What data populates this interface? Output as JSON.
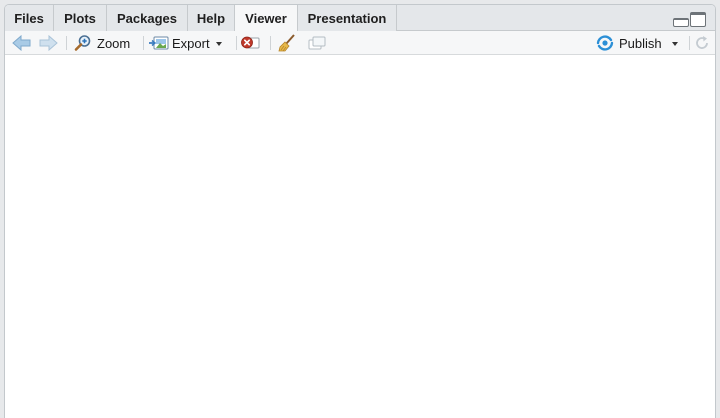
{
  "tabs": [
    {
      "label": "Files",
      "active": false
    },
    {
      "label": "Plots",
      "active": false
    },
    {
      "label": "Packages",
      "active": false
    },
    {
      "label": "Help",
      "active": false
    },
    {
      "label": "Viewer",
      "active": true
    },
    {
      "label": "Presentation",
      "active": false
    }
  ],
  "toolbar": {
    "back_icon": "arrow-left-icon",
    "forward_icon": "arrow-right-icon",
    "zoom_label": "Zoom",
    "export_label": "Export",
    "remove_icon": "remove-circle-icon",
    "clear_icon": "broom-icon",
    "popout_icon": "show-in-new-window-icon",
    "publish_label": "Publish",
    "refresh_icon": "refresh-icon"
  },
  "colors": {
    "accent_blue": "#4a90c8",
    "publish_blue": "#2b8fd6",
    "remove_red": "#c0392b"
  }
}
